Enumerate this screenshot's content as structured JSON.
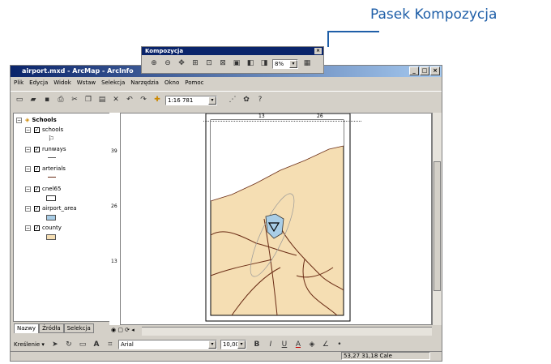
{
  "callout": {
    "label": "Pasek Kompozycja"
  },
  "window": {
    "title": "airport.mxd - ArcMap - ArcInfo",
    "min": "_",
    "max": "□",
    "close": "×"
  },
  "menu": [
    "Plik",
    "Edycja",
    "Widok",
    "Wstaw",
    "Selekcja",
    "Narzędzia",
    "Okno",
    "Pomoc"
  ],
  "toolbar": {
    "scale": "1:16 781"
  },
  "toc": {
    "root": "Schools",
    "layers": [
      "schools",
      "runways",
      "arterials",
      "cnel65",
      "airport_area",
      "county"
    ],
    "tabs": [
      "Nazwy",
      "Źródła",
      "Selekcja"
    ]
  },
  "ruler": {
    "h1": "13",
    "h2": "26",
    "v1": "39",
    "v2": "26",
    "v3": "13"
  },
  "floating_toolbar": {
    "title": "Kompozycja",
    "zoom": "8%"
  },
  "drawing": {
    "label": "Kreślenie ▾",
    "font": "Arial",
    "size": "10,00",
    "bold": "B",
    "italic": "I",
    "underline": "U",
    "text_color": "A"
  },
  "status": {
    "coords": "53,27  31,18 Cale"
  },
  "colors": {
    "land": "#f5deb3",
    "roads": "#6b2d16",
    "airport": "#a9cde6"
  }
}
